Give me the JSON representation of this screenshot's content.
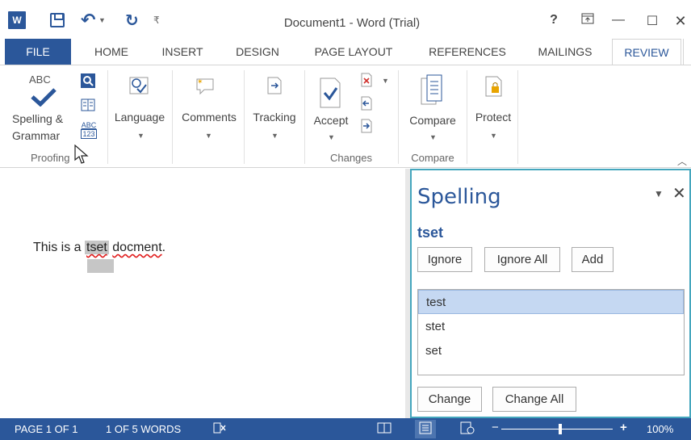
{
  "titlebar": {
    "app_icon": "W",
    "title": "Document1 - Word (Trial)",
    "undo": "↶",
    "redo": "↻",
    "help": "?",
    "minimize": "—",
    "maximize": "☐",
    "close": "✕"
  },
  "tabs": [
    {
      "label": "FILE"
    },
    {
      "label": "HOME"
    },
    {
      "label": "INSERT"
    },
    {
      "label": "DESIGN"
    },
    {
      "label": "PAGE LAYOUT"
    },
    {
      "label": "REFERENCES"
    },
    {
      "label": "MAILINGS"
    },
    {
      "label": "REVIEW"
    }
  ],
  "ribbon": {
    "proofing": {
      "abc": "ABC",
      "button_line1": "Spelling &",
      "button_line2": "Grammar",
      "word_count_top": "ABC",
      "word_count_bottom": "123",
      "group_label": "Proofing"
    },
    "language": {
      "label": "Language"
    },
    "comments": {
      "label": "Comments"
    },
    "tracking": {
      "label": "Tracking"
    },
    "changes": {
      "accept_label": "Accept",
      "group_label": "Changes"
    },
    "compare": {
      "label": "Compare",
      "group_label": "Compare"
    },
    "protect": {
      "label": "Protect"
    }
  },
  "document": {
    "text_before": "This is a ",
    "highlighted_word": "tset",
    "text_space": " ",
    "misspelled_word": "docment",
    "text_after": "."
  },
  "spelling_pane": {
    "title": "Spelling",
    "misspelled": "tset",
    "ignore_label": "Ignore",
    "ignore_all_label": "Ignore All",
    "add_label": "Add",
    "suggestions": [
      "test",
      "stet",
      "set"
    ],
    "change_label": "Change",
    "change_all_label": "Change All"
  },
  "statusbar": {
    "page": "PAGE 1 OF 1",
    "words": "1 OF 5 WORDS",
    "zoom_minus": "−",
    "zoom_plus": "+",
    "zoom": "100%"
  },
  "colors": {
    "accent": "#2b579a",
    "pane_border": "#44a6bd",
    "selection": "#c5d8f2"
  }
}
